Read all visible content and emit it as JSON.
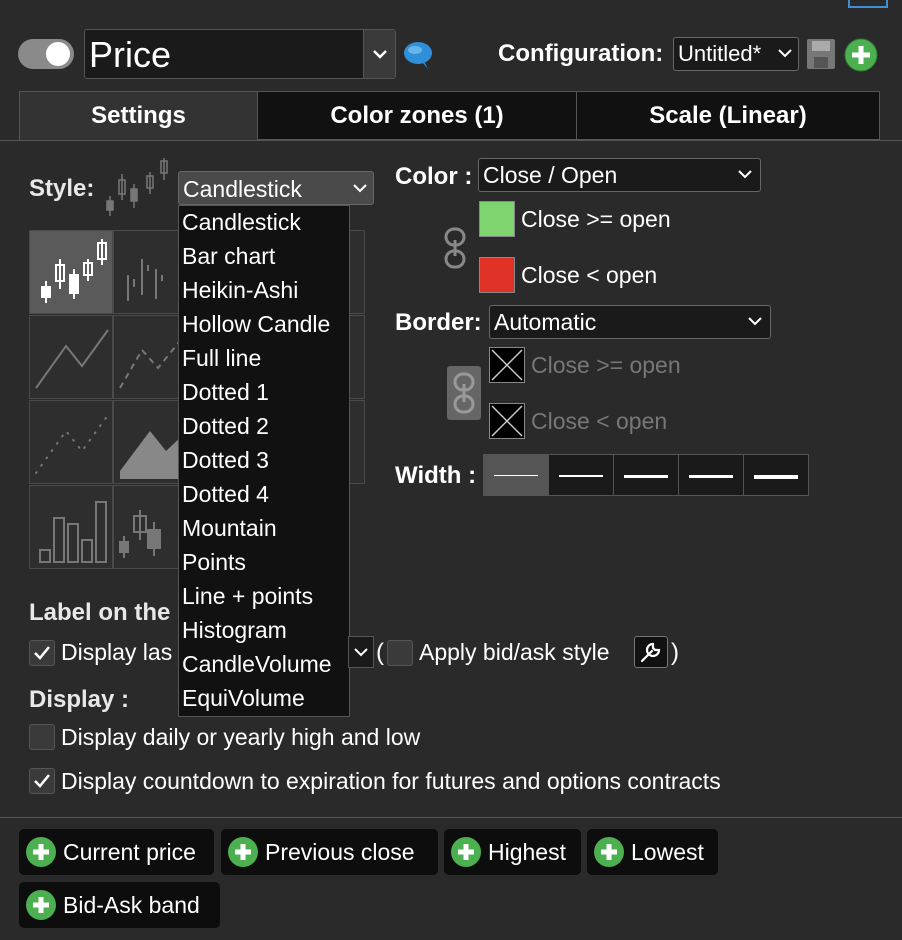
{
  "header": {
    "title": "Price",
    "configuration_label": "Configuration:",
    "configuration_value": "Untitled*"
  },
  "tabs": [
    {
      "label": "Settings",
      "active": true
    },
    {
      "label": "Color zones (1)",
      "active": false
    },
    {
      "label": "Scale (Linear)",
      "active": false
    }
  ],
  "style": {
    "label": "Style:",
    "selected": "Candlestick",
    "options": [
      "Candlestick",
      "Bar chart",
      "Heikin-Ashi",
      "Hollow Candle",
      "Full line",
      "Dotted 1",
      "Dotted 2",
      "Dotted 3",
      "Dotted 4",
      "Mountain",
      "Points",
      "Line + points",
      "Histogram",
      "CandleVolume",
      "EquiVolume"
    ]
  },
  "color": {
    "label": "Color :",
    "selected": "Close / Open",
    "zones": [
      {
        "text": "Close >= open",
        "color": "#7ed56f"
      },
      {
        "text": "Close < open",
        "color": "#e03127"
      }
    ]
  },
  "border": {
    "label": "Border:",
    "selected": "Automatic",
    "zones": [
      {
        "text": "Close >= open"
      },
      {
        "text": "Close < open"
      }
    ]
  },
  "width": {
    "label": "Width :",
    "selected_index": 0
  },
  "label_section": {
    "title_visible": "Label on the",
    "display_last_visible": "Display las",
    "apply_bid_ask": "Apply bid/ask style",
    "paren_open": "(",
    "paren_close": ")"
  },
  "display": {
    "title": "Display :",
    "items": [
      {
        "text": "Display daily or yearly high and low",
        "checked": false
      },
      {
        "text": "Display countdown to expiration for futures and options contracts",
        "checked": true
      }
    ]
  },
  "add_buttons": [
    "Current price",
    "Previous close",
    "Highest",
    "Lowest",
    "Bid-Ask band"
  ],
  "colors": {
    "background": "#2a2a2a",
    "accent_green": "#4caf50",
    "chat_blue": "#2f8fd8"
  }
}
